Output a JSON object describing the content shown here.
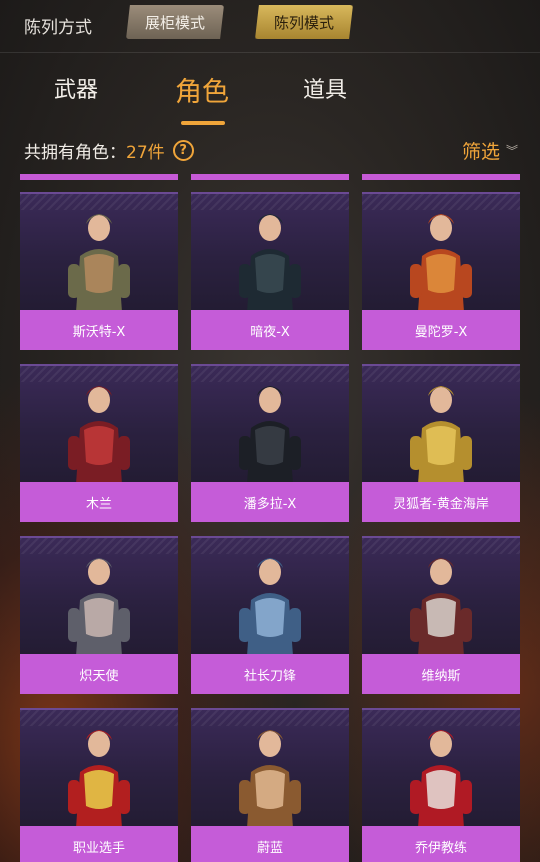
{
  "header": {
    "arrange_label": "陈列方式",
    "showcase_mode": "展柜模式",
    "list_mode": "陈列模式"
  },
  "tabs": [
    {
      "label": "武器",
      "active": false
    },
    {
      "label": "角色",
      "active": true
    },
    {
      "label": "道具",
      "active": false
    }
  ],
  "summary": {
    "prefix": "共拥有角色：",
    "count": "27件",
    "help_glyph": "?",
    "filter_label": "筛选"
  },
  "colors": {
    "accent": "#f0a53a",
    "name_bar": "#c55cd8",
    "card_bg": "#2b2140"
  },
  "characters": [
    {
      "name": "斯沃特-X",
      "icon": "soldier-figure"
    },
    {
      "name": "暗夜-X",
      "icon": "agent-figure"
    },
    {
      "name": "曼陀罗-X",
      "icon": "redhead-figure"
    },
    {
      "name": "木兰",
      "icon": "red-outfit-figure"
    },
    {
      "name": "潘多拉-X",
      "icon": "dark-suit-figure"
    },
    {
      "name": "灵狐者-黄金海岸",
      "icon": "gold-outfit-figure"
    },
    {
      "name": "炽天使",
      "icon": "lace-outfit-figure"
    },
    {
      "name": "社长刀锋",
      "icon": "denim-figure"
    },
    {
      "name": "维纳斯",
      "icon": "silver-hair-figure"
    },
    {
      "name": "职业选手",
      "icon": "racer-figure"
    },
    {
      "name": "蔚蓝",
      "icon": "brown-outfit-figure"
    },
    {
      "name": "乔伊教练",
      "icon": "red-coat-figure"
    }
  ]
}
